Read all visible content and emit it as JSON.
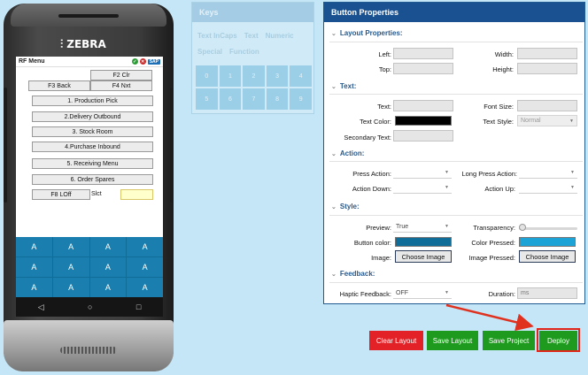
{
  "phone": {
    "brand": "ZEBRA",
    "logo_icon": "zebra-logo-icon",
    "rf_title": "RF Menu",
    "status_badges": [
      "✓",
      "✕"
    ],
    "sap_badge": "SAP",
    "buttons": {
      "f2": "F2 Clr",
      "f3": "F3 Back",
      "f4": "F4 Nxt",
      "menu": [
        "1. Production Pick",
        "2.Delivery Outbound",
        "3. Stock Room",
        "4.Purchase Inbound",
        "5. Receiving Menu",
        "6. Order Spares"
      ],
      "f8": "F8 LOff",
      "slct_label": "Slct"
    },
    "keypad_key": "A",
    "nav": [
      "◁",
      "○",
      "□"
    ]
  },
  "keys_panel": {
    "title": "Keys",
    "tabs_row1": [
      "Text InCaps",
      "Text",
      "Numeric"
    ],
    "tabs_row2": [
      "Special",
      "Function"
    ],
    "keys": [
      "0",
      "1",
      "2",
      "3",
      "4",
      "5",
      "6",
      "7",
      "8",
      "9"
    ]
  },
  "props": {
    "title": "Button Properties",
    "sections": {
      "layout": "Layout Properties:",
      "text": "Text:",
      "action": "Action:",
      "style": "Style:",
      "feedback": "Feedback:"
    },
    "labels": {
      "left": "Left:",
      "width": "Width:",
      "top": "Top:",
      "height": "Height:",
      "text": "Text:",
      "font_size": "Font Size:",
      "text_color": "Text Color:",
      "text_style": "Text Style:",
      "secondary_text": "Secondary Text:",
      "press_action": "Press Action:",
      "long_press_action": "Long Press Action:",
      "action_down": "Action Down:",
      "action_up": "Action Up:",
      "preview": "Preview:",
      "transparency": "Transparency:",
      "button_color": "Button color:",
      "color_pressed": "Color Pressed:",
      "image": "Image:",
      "image_pressed": "Image Pressed:",
      "haptic": "Haptic Feedback:",
      "duration": "Duration:"
    },
    "values": {
      "text_style": "Normal",
      "preview": "True",
      "haptic": "OFF",
      "duration_placeholder": "ms",
      "choose_image": "Choose Image",
      "choose_image_pressed": "Choose Image"
    },
    "colors": {
      "text_color": "#000000",
      "button_color": "#0f6d98",
      "color_pressed": "#1ea3d6"
    },
    "transparency_level": 0
  },
  "actions": {
    "clear_layout": "Clear Layout",
    "save_layout": "Save Layout",
    "save_project": "Save Project",
    "deploy": "Deploy"
  }
}
